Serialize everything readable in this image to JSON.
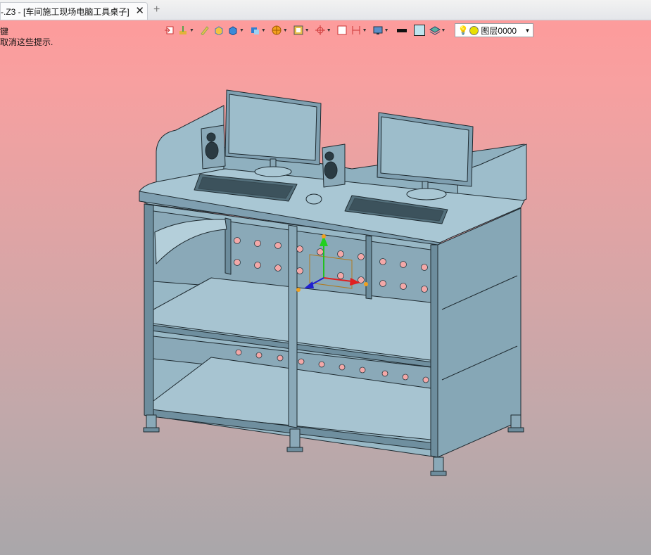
{
  "tab": {
    "title": "-.Z3 - [车间施工现场电脑工具桌子]",
    "close": "✕",
    "add": "+"
  },
  "hints": {
    "line1": "键",
    "line2": "取消这些提示."
  },
  "toolbar": {
    "icons": [
      "exit-icon",
      "paint-brush-icon",
      "pencil-icon",
      "shade-box-icon",
      "solid-box-icon",
      "view-cube-icon",
      "orange-star-icon",
      "frame-icon",
      "origin-axis-icon",
      "window-icon",
      "dimension-icon",
      "display-icon",
      "line-color",
      "fill-color",
      "layer-stack-icon"
    ],
    "layer": {
      "name": "图层0000"
    }
  },
  "colors": {
    "background_top": "#ff9a9a",
    "background_bottom": "#a9a7aa",
    "model": "#98b8c6",
    "model_dark": "#7f9fb0",
    "hole": "#f3a8a8"
  }
}
